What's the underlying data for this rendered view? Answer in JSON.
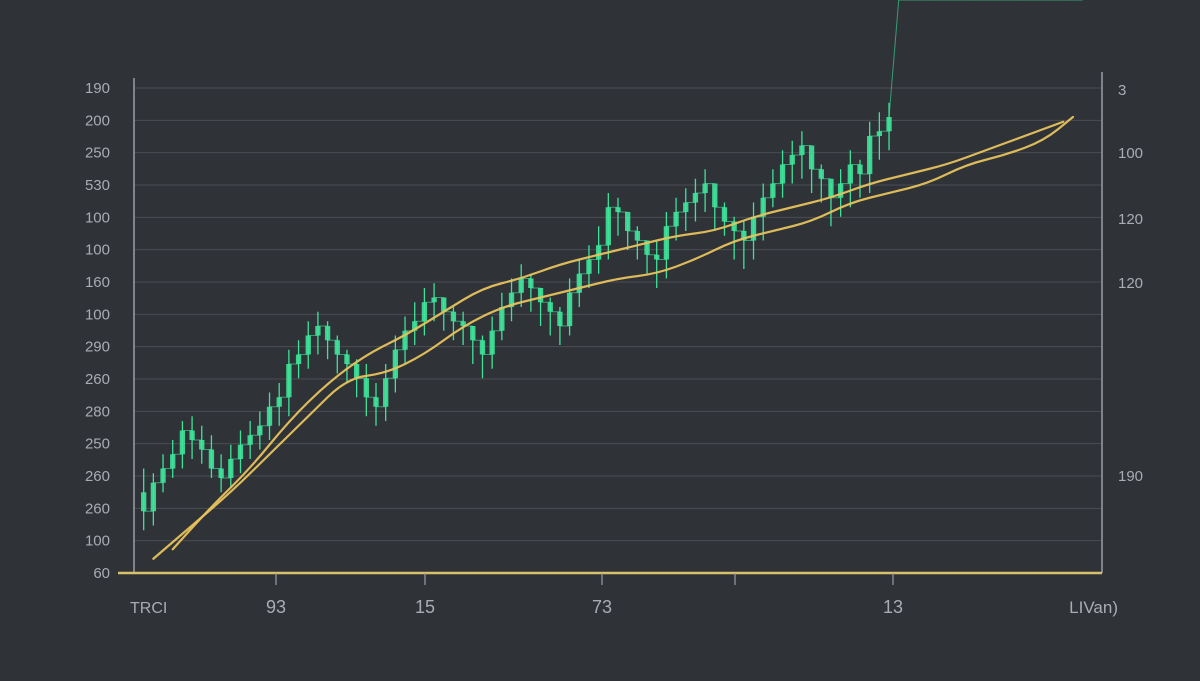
{
  "chart_data": {
    "type": "line",
    "title": "",
    "xlabel": "",
    "ylabel": "",
    "grid": true,
    "legend": "none",
    "x_ticks_left": "TRCI",
    "x_ticks": [
      "93",
      "15",
      "73",
      "13"
    ],
    "x_ticks_right": "LIVan)",
    "y_left_ticks": [
      "190",
      "200",
      "250",
      "530",
      "100",
      "100",
      "160",
      "100",
      "290",
      "260",
      "280",
      "250",
      "260",
      "260",
      "100",
      "60"
    ],
    "y_right_ticks": [
      "3",
      "100",
      "120",
      "120",
      "190"
    ],
    "ylim": [
      0,
      100
    ],
    "xlim": [
      0,
      100
    ],
    "series": [
      {
        "kind": "candles",
        "color": "#3ee39a",
        "x": [
          1,
          2,
          3,
          4,
          5,
          6,
          7,
          8,
          9,
          10,
          11,
          12,
          13,
          14,
          15,
          16,
          17,
          18,
          19,
          20,
          21,
          22,
          23,
          24,
          25,
          26,
          27,
          28,
          29,
          30,
          31,
          32,
          33,
          34,
          35,
          36,
          37,
          38,
          39,
          40,
          41,
          42,
          43,
          44,
          45,
          46,
          47,
          48,
          49,
          50,
          51,
          52,
          53,
          54,
          55,
          56,
          57,
          58,
          59,
          60,
          61,
          62,
          63,
          64,
          65,
          66,
          67,
          68,
          69,
          70,
          71,
          72,
          73,
          74,
          75,
          76,
          77,
          78,
          79,
          80,
          81,
          82,
          83,
          84,
          85,
          86,
          87,
          88,
          89,
          90,
          91,
          92,
          93,
          94,
          95,
          96,
          97,
          98
        ],
        "open": [
          17,
          13,
          19,
          22,
          25,
          30,
          28,
          26,
          22,
          20,
          24,
          27,
          29,
          31,
          35,
          37,
          44,
          46,
          50,
          52,
          49,
          46,
          44,
          41,
          37,
          35,
          41,
          47,
          51,
          53,
          57,
          58,
          55,
          53,
          52,
          49,
          46,
          51,
          56,
          59,
          62,
          60,
          57,
          55,
          52,
          59,
          63,
          66,
          69,
          77,
          76,
          72,
          70,
          67,
          66,
          73,
          76,
          78,
          80,
          82,
          77,
          74,
          72,
          70,
          75,
          79,
          82,
          86,
          88,
          90,
          85,
          83,
          79,
          82,
          86,
          84,
          92,
          93
        ],
        "close": [
          13,
          19,
          22,
          25,
          30,
          28,
          26,
          22,
          20,
          24,
          27,
          29,
          31,
          35,
          37,
          44,
          46,
          50,
          52,
          49,
          46,
          44,
          41,
          37,
          35,
          41,
          47,
          51,
          53,
          57,
          58,
          55,
          53,
          52,
          49,
          46,
          51,
          56,
          59,
          62,
          60,
          57,
          55,
          52,
          59,
          63,
          66,
          69,
          77,
          76,
          72,
          70,
          67,
          66,
          73,
          76,
          78,
          80,
          82,
          77,
          74,
          72,
          70,
          75,
          79,
          82,
          86,
          88,
          90,
          85,
          83,
          79,
          82,
          86,
          84,
          92,
          93,
          96
        ],
        "high": [
          22,
          21,
          25,
          28,
          32,
          33,
          31,
          29,
          25,
          27,
          30,
          32,
          34,
          38,
          40,
          47,
          49,
          53,
          55,
          53,
          50,
          47,
          45,
          44,
          40,
          44,
          50,
          54,
          57,
          60,
          61,
          58,
          56,
          55,
          52,
          50,
          54,
          59,
          62,
          65,
          63,
          60,
          58,
          56,
          62,
          66,
          69,
          73,
          80,
          79,
          75,
          73,
          70,
          70,
          76,
          79,
          81,
          83,
          85,
          81,
          78,
          75,
          74,
          78,
          82,
          85,
          89,
          91,
          93,
          88,
          86,
          82,
          85,
          89,
          87,
          95,
          97,
          99
        ],
        "low": [
          9,
          10,
          17,
          20,
          22,
          24,
          23,
          20,
          17,
          18,
          21,
          24,
          26,
          28,
          31,
          33,
          41,
          43,
          46,
          45,
          42,
          40,
          37,
          33,
          31,
          32,
          38,
          44,
          48,
          50,
          53,
          51,
          49,
          48,
          44,
          41,
          43,
          49,
          53,
          56,
          55,
          52,
          50,
          48,
          50,
          56,
          60,
          63,
          66,
          71,
          68,
          66,
          63,
          60,
          62,
          70,
          72,
          74,
          76,
          72,
          71,
          66,
          64,
          66,
          70,
          77,
          79,
          82,
          83,
          80,
          78,
          73,
          75,
          77,
          79,
          80,
          87,
          89
        ]
      },
      {
        "kind": "line",
        "color": "#e7c35c",
        "x": [
          2,
          6,
          10,
          14,
          18,
          22,
          26,
          30,
          34,
          38,
          42,
          46,
          50,
          54,
          58,
          62,
          66,
          70,
          74,
          78,
          82,
          86,
          90,
          94,
          97
        ],
        "y": [
          3,
          10,
          17,
          25,
          33,
          41,
          42,
          46,
          52,
          56,
          58,
          60,
          62,
          63,
          66,
          70,
          72,
          74,
          78,
          80,
          82,
          86,
          88,
          91,
          96
        ]
      },
      {
        "kind": "line",
        "color": "#e7c35c",
        "x": [
          4,
          8,
          12,
          16,
          20,
          24,
          28,
          32,
          36,
          40,
          44,
          48,
          52,
          56,
          60,
          64,
          68,
          72,
          76,
          80,
          84,
          88,
          92,
          96
        ],
        "y": [
          5,
          14,
          22,
          32,
          40,
          46,
          50,
          55,
          60,
          62,
          65,
          67,
          69,
          71,
          72,
          75,
          77,
          79,
          82,
          84,
          86,
          89,
          92,
          95
        ]
      }
    ]
  }
}
